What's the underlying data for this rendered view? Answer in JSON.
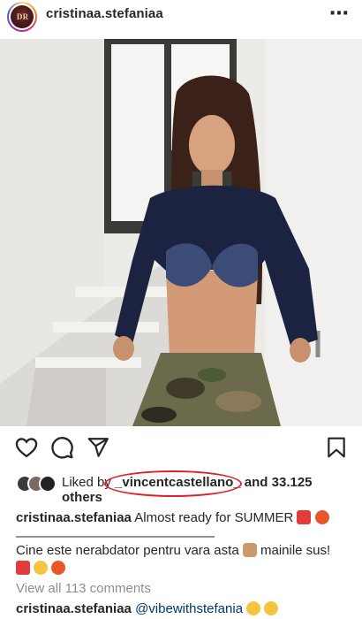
{
  "header": {
    "avatar_initials": "D R",
    "username": "cristinaa.stefaniaa",
    "more_icon": "⋯"
  },
  "likes": {
    "prefix": "Liked by",
    "user": "_vincentcastellano_",
    "suffix": "and 33.125",
    "line2": "others"
  },
  "caption": {
    "username": "cristinaa.stefaniaa",
    "text": "Almost ready for SUMMER",
    "divider": "————————————————",
    "line2_text": "Cine este nerabdator pentru vara asta",
    "line2_suffix": "mainile sus!"
  },
  "view_all": "View all 113 comments",
  "comment": {
    "username": "cristinaa.stefaniaa",
    "mention": "@vibewithstefania"
  },
  "icons": [
    "heart-icon",
    "comment-icon",
    "share-icon",
    "bookmark-icon",
    "more-icon"
  ],
  "colors": {
    "highlight": "#e0202a",
    "mention": "#00376b",
    "muted": "#8e8e8e"
  }
}
